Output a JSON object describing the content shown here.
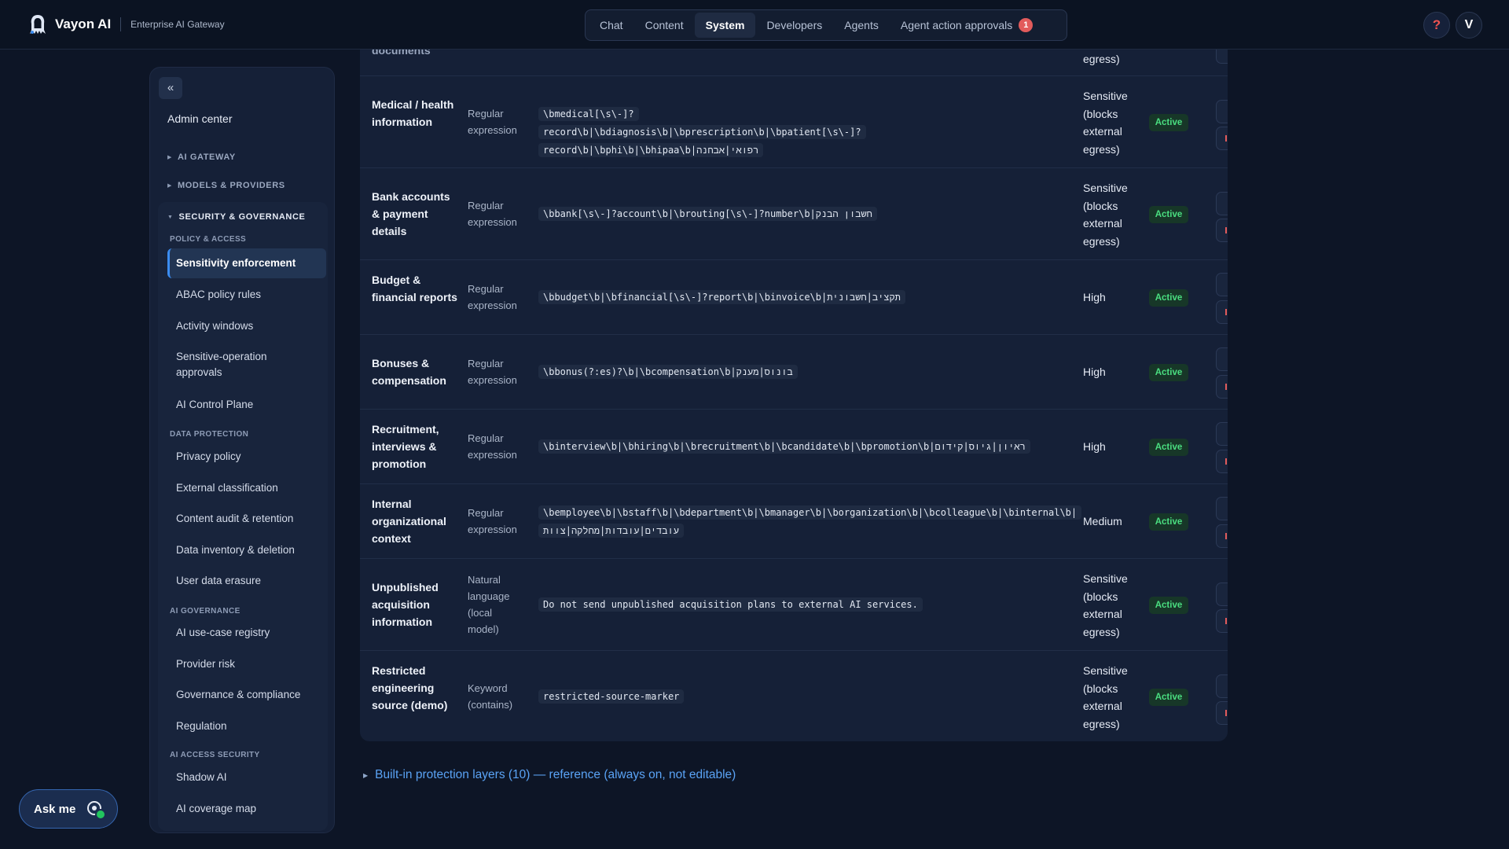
{
  "brand": {
    "name": "Vayon AI",
    "subtitle": "Enterprise AI Gateway"
  },
  "nav": {
    "tabs": [
      {
        "label": "Chat"
      },
      {
        "label": "Content"
      },
      {
        "label": "System",
        "active": true
      },
      {
        "label": "Developers"
      },
      {
        "label": "Agents"
      },
      {
        "label": "Agent action approvals",
        "badge": "1"
      }
    ],
    "help_label": "?",
    "avatar_initial": "V"
  },
  "sidebar": {
    "collapse_label": "«",
    "title": "Admin center",
    "sections": [
      {
        "label": "AI GATEWAY"
      },
      {
        "label": "MODELS & PROVIDERS"
      },
      {
        "label": "SECURITY & GOVERNANCE"
      }
    ],
    "groups": [
      {
        "label": "POLICY & ACCESS",
        "items": [
          "Sensitivity enforcement",
          "ABAC policy rules",
          "Activity windows",
          "Sensitive-operation approvals",
          "AI Control Plane"
        ]
      },
      {
        "label": "DATA PROTECTION",
        "items": [
          "Privacy policy",
          "External classification",
          "Content audit & retention",
          "Data inventory & deletion",
          "User data erasure"
        ]
      },
      {
        "label": "AI GOVERNANCE",
        "items": [
          "AI use-case registry",
          "Provider risk",
          "Governance & compliance",
          "Regulation"
        ]
      },
      {
        "label": "AI ACCESS SECURITY",
        "items": [
          "Shadow AI",
          "AI coverage map"
        ]
      }
    ]
  },
  "ask_me": {
    "label": "Ask me"
  },
  "table": {
    "top_partial": {
      "name": "documents",
      "level": "egress)"
    },
    "rows": [
      {
        "name": "Medical / health information",
        "type": "Regular expression",
        "pattern": "\\bmedical[\\s\\-]?record\\b|\\bdiagnosis\\b|\\bprescription\\b|\\bpatient[\\s\\-]?record\\b|\\bphi\\b|\\bhipaa\\b|רפואי|אבחנה",
        "level": "Sensitive (blocks external egress)",
        "status": "Active"
      },
      {
        "name": "Bank accounts & payment details",
        "type": "Regular expression",
        "pattern": "\\bbank[\\s\\-]?account\\b|\\brouting[\\s\\-]?number\\b|חשבון הבנק",
        "level": "Sensitive (blocks external egress)",
        "status": "Active"
      },
      {
        "name": "Budget & financial reports",
        "type": "Regular expression",
        "pattern": "\\bbudget\\b|\\bfinancial[\\s\\-]?report\\b|\\binvoice\\b|תקציב|חשבונית",
        "level": "High",
        "status": "Active"
      },
      {
        "name": "Bonuses & compensation",
        "type": "Regular expression",
        "pattern": "\\bbonus(?:es)?\\b|\\bcompensation\\b|בונוס|מענק",
        "level": "High",
        "status": "Active"
      },
      {
        "name": "Recruitment, interviews & promotion",
        "type": "Regular expression",
        "pattern": "\\binterview\\b|\\bhiring\\b|\\brecruitment\\b|\\bcandidate\\b|\\bpromotion\\b|ראיון|גיוס|קידום",
        "level": "High",
        "status": "Active"
      },
      {
        "name": "Internal organizational context",
        "type": "Regular expression",
        "pattern": "\\bemployee\\b|\\bstaff\\b|\\bdepartment\\b|\\bmanager\\b|\\borganization\\b|\\bcolleague\\b|\\binternal\\b|עובדים|עובדות|מחלקה|צוות",
        "level": "Medium",
        "status": "Active"
      },
      {
        "name": "Unpublished acquisition information",
        "type": "Natural language (local model)",
        "pattern": "Do not send unpublished acquisition plans to external AI services.",
        "level": "Sensitive (blocks external egress)",
        "status": "Active"
      },
      {
        "name": "Restricted engineering source (demo)",
        "type": "Keyword (contains)",
        "pattern": "restricted-source-marker",
        "level": "Sensitive (blocks external egress)",
        "status": "Active"
      }
    ]
  },
  "builtin_link": "Built-in protection layers (10) — reference (always on, not editable)",
  "colors": {
    "accent": "#3b8cf0",
    "active_status": "#4ade80",
    "danger": "#e25b5b",
    "link": "#5aa3f5"
  }
}
